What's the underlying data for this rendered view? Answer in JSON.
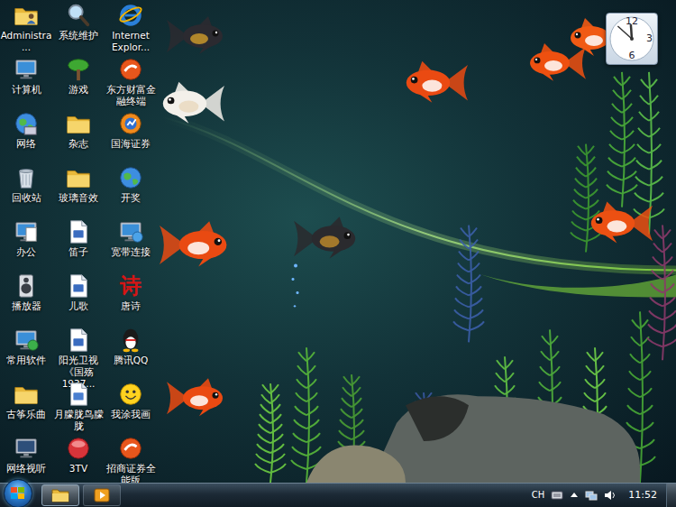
{
  "desktop": {
    "icons": [
      {
        "label": "Administra..."
      },
      {
        "label": "计算机"
      },
      {
        "label": "网络"
      },
      {
        "label": "回收站"
      },
      {
        "label": "办公"
      },
      {
        "label": "播放器"
      },
      {
        "label": "常用软件"
      },
      {
        "label": "古筝乐曲"
      },
      {
        "label": "网络视听"
      },
      {
        "label": "系统维护"
      },
      {
        "label": "游戏"
      },
      {
        "label": "杂志"
      },
      {
        "label": "玻璃音效"
      },
      {
        "label": "笛子"
      },
      {
        "label": "儿歌"
      },
      {
        "label": "阳光卫视《国殇1937..."
      },
      {
        "label": "月朦胧鸟朦胧"
      },
      {
        "label": "3TV"
      },
      {
        "label": "Internet Explor..."
      },
      {
        "label": "东方财富金融终端"
      },
      {
        "label": "国海证券"
      },
      {
        "label": "开奖"
      },
      {
        "label": "宽带连接"
      },
      {
        "label": "唐诗",
        "glyph": "诗"
      },
      {
        "label": "腾讯QQ"
      },
      {
        "label": "我涂我画"
      },
      {
        "label": "招商证券全能版"
      }
    ]
  },
  "gadget": {
    "clock": {
      "numbers": [
        "12",
        "3",
        "6"
      ]
    }
  },
  "taskbar": {
    "buttons": [
      {
        "selected": true
      },
      {
        "selected": false
      }
    ],
    "tray": {
      "language": "CH",
      "time": "11:52"
    }
  }
}
